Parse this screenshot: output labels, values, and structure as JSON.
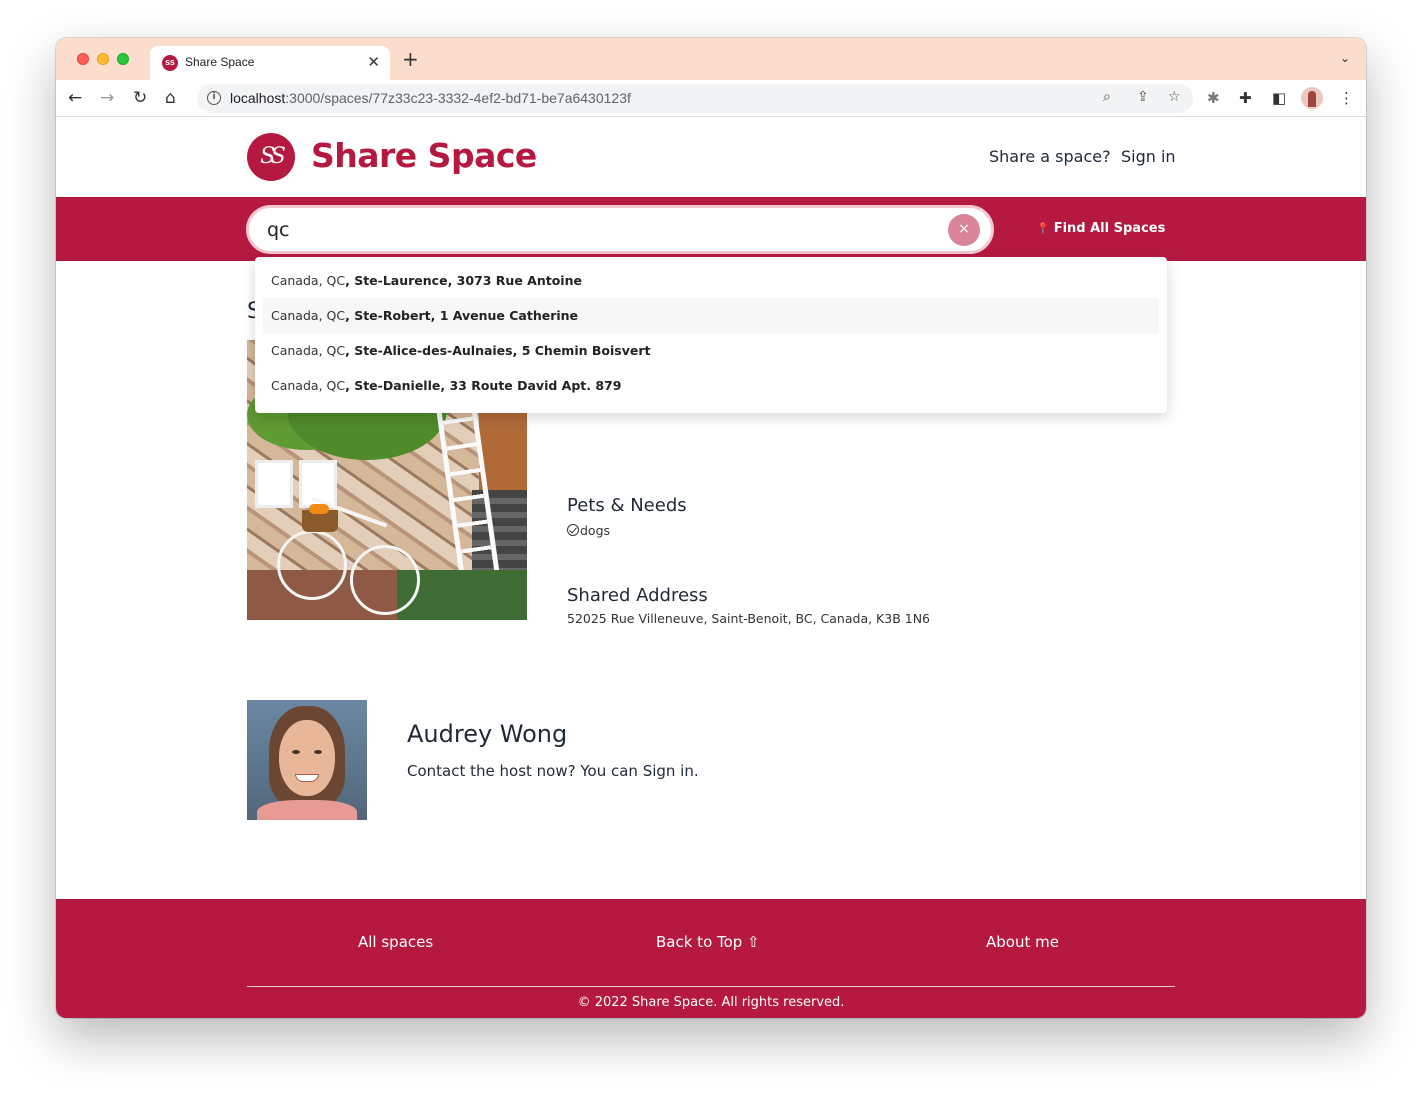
{
  "browser": {
    "tab_title": "Share Space",
    "tab_favicon": "SS",
    "url_host": "localhost",
    "url_path": ":3000/spaces/77z33c23-3332-4ef2-bd71-be7a6430123f",
    "icons": [
      "back-icon",
      "forward-icon",
      "reload-icon",
      "home-icon",
      "info-icon",
      "zoom-icon",
      "share-icon",
      "star-icon",
      "bug-extension-icon",
      "puzzle-extension-icon",
      "side-panel-icon",
      "profile-avatar",
      "more-menu-icon"
    ]
  },
  "header": {
    "logo_mark": "SS",
    "logo_text": "Share Space",
    "share_link": "Share a space?",
    "signin_link": "Sign in"
  },
  "search": {
    "value": "qc",
    "clear_label": "×",
    "find_all_label": "Find All Spaces",
    "suggestions": [
      {
        "prefix": "Canada, QC",
        "bold": ", Ste-Laurence, 3073 Rue Antoine"
      },
      {
        "prefix": "Canada, QC",
        "bold": ", Ste-Robert, 1 Avenue Catherine"
      },
      {
        "prefix": "Canada, QC",
        "bold": ", Ste-Alice-des-Aulnaies, 5 Chemin Boisvert"
      },
      {
        "prefix": "Canada, QC",
        "bold": ", Ste-Danielle, 33 Route David Apt. 879"
      }
    ]
  },
  "space": {
    "section_letter": "S",
    "pets_heading": "Pets & Needs",
    "pets_value": "dogs",
    "address_heading": "Shared Address",
    "address_value": "52025 Rue Villeneuve, Saint-Benoit, BC, Canada, K3B 1N6"
  },
  "host": {
    "name": "Audrey Wong",
    "contact_prefix": "Contact the host now? You can ",
    "contact_link": "Sign in",
    "contact_suffix": "."
  },
  "footer": {
    "all_spaces": "All spaces",
    "back_to_top": "Back to Top ⇧",
    "about_me": "About me",
    "copyright": "© 2022 Share Space. All rights reserved."
  },
  "colors": {
    "brand": "#b5193f",
    "tabstrip": "#fcdccd"
  }
}
